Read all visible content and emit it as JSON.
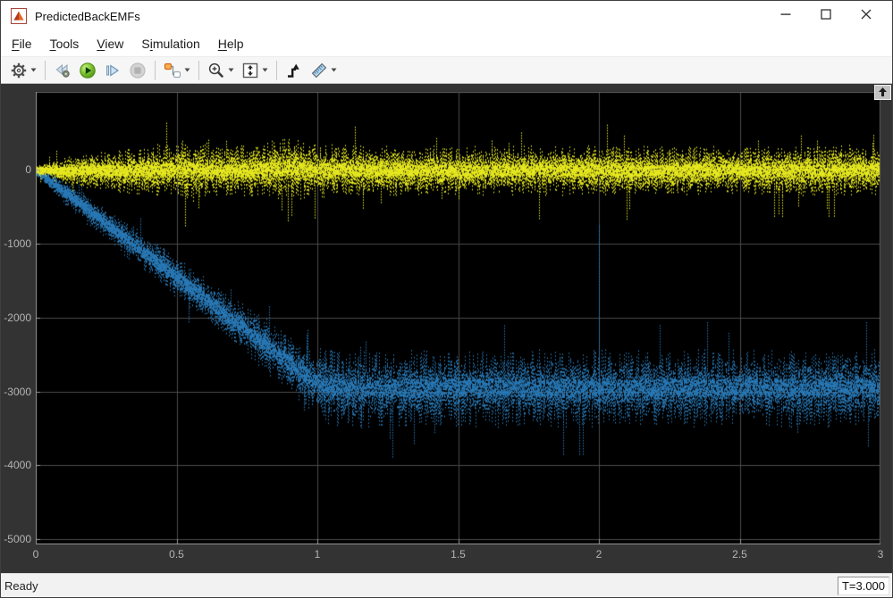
{
  "window": {
    "title": "PredictedBackEMFs",
    "controls": {
      "minimize": "minimize",
      "maximize": "maximize",
      "close": "close"
    }
  },
  "menubar": {
    "items": [
      {
        "label": "File",
        "underline": 0
      },
      {
        "label": "Tools",
        "underline": 0
      },
      {
        "label": "View",
        "underline": 0
      },
      {
        "label": "Simulation",
        "underline": 1
      },
      {
        "label": "Help",
        "underline": 0
      }
    ]
  },
  "toolbar": {
    "items": [
      {
        "icon": "settings-gear-icon",
        "caret": true
      },
      {
        "separator": true
      },
      {
        "icon": "step-back-icon",
        "disabled": true
      },
      {
        "icon": "run-icon"
      },
      {
        "icon": "step-forward-icon"
      },
      {
        "icon": "stop-icon",
        "disabled": true
      },
      {
        "separator": true
      },
      {
        "icon": "simulink-blocks-icon",
        "caret": true
      },
      {
        "separator": true
      },
      {
        "icon": "zoom-in-icon",
        "caret": true
      },
      {
        "icon": "fit-to-view-icon",
        "caret": true
      },
      {
        "separator": true
      },
      {
        "icon": "trigger-icon"
      },
      {
        "icon": "measurements-icon",
        "caret": true
      }
    ]
  },
  "chart_data": {
    "type": "scatter",
    "title": "",
    "xlabel": "",
    "ylabel": "",
    "grid": true,
    "xlim": [
      0,
      3
    ],
    "ylim": [
      -5070,
      1050
    ],
    "xticks": {
      "values": [
        0,
        0.5,
        1,
        1.5,
        2,
        2.5,
        3
      ],
      "labels": [
        "0",
        "0.5",
        "1",
        "1.5",
        "2",
        "2.5",
        "3"
      ]
    },
    "yticks": {
      "values": [
        0,
        -1000,
        -2000,
        -3000,
        -4000,
        -5000
      ],
      "labels": [
        "0",
        "-1000",
        "-2000",
        "-3000",
        "-4000",
        "-5000"
      ]
    },
    "colors": {
      "plot_bg": "#000000",
      "margin_bg": "#333333",
      "grid": "#4b4b4b",
      "frame": "#9b9b9b",
      "frame_dim": "#5c5c5c",
      "tick_label": "#b4b4b4"
    },
    "series": [
      {
        "name": "predicted-backemf-blue",
        "color": "#2878b5",
        "seed": 7,
        "description": "noisy signal ramping from 0 at t=0 to about -2950 at t=1, then constant near -2950 until t=3",
        "envelope": [
          [
            0,
            0,
            80
          ],
          [
            0.1,
            -290,
            150
          ],
          [
            0.2,
            -580,
            180
          ],
          [
            0.3,
            -870,
            200
          ],
          [
            0.4,
            -1160,
            220
          ],
          [
            0.5,
            -1450,
            240
          ],
          [
            0.6,
            -1740,
            260
          ],
          [
            0.7,
            -2030,
            280
          ],
          [
            0.8,
            -2320,
            310
          ],
          [
            0.9,
            -2610,
            340
          ],
          [
            0.95,
            -2760,
            370
          ],
          [
            1.0,
            -2880,
            410
          ],
          [
            1.05,
            -2940,
            440
          ],
          [
            1.1,
            -2960,
            450
          ],
          [
            1.5,
            -2950,
            445
          ],
          [
            2.0,
            -2955,
            450
          ],
          [
            2.5,
            -2945,
            445
          ],
          [
            3.0,
            -2950,
            450
          ]
        ],
        "spikes": [
          {
            "x": 2.0,
            "from": -750,
            "to": -3250
          }
        ],
        "texture": {
          "dots_per_column": 8,
          "dash_prob": 0.8,
          "dash_min": 0.25,
          "dash_max": 1.2,
          "outlier_prob": 0.03,
          "outlier_factor": 1.6
        }
      },
      {
        "name": "predicted-backemf-yellow",
        "color": "#e6e81f",
        "seed": 11,
        "description": "noisy signal oscillating about 0 with band of roughly +/-300 for full duration",
        "envelope": [
          [
            0,
            0,
            60
          ],
          [
            0.05,
            0,
            110
          ],
          [
            0.1,
            -20,
            170
          ],
          [
            0.2,
            0,
            240
          ],
          [
            0.3,
            -15,
            270
          ],
          [
            0.4,
            0,
            290
          ],
          [
            0.5,
            15,
            330
          ],
          [
            0.55,
            0,
            370
          ],
          [
            0.65,
            -15,
            300
          ],
          [
            0.8,
            0,
            330
          ],
          [
            0.9,
            25,
            390
          ],
          [
            1.0,
            -10,
            330
          ],
          [
            1.2,
            0,
            300
          ],
          [
            1.5,
            -15,
            310
          ],
          [
            1.8,
            0,
            300
          ],
          [
            2.1,
            -10,
            300
          ],
          [
            2.4,
            0,
            295
          ],
          [
            2.7,
            -10,
            300
          ],
          [
            3.0,
            0,
            300
          ]
        ],
        "spikes": [],
        "texture": {
          "dots_per_column": 9,
          "dash_prob": 0.85,
          "dash_min": 0.25,
          "dash_max": 1.15,
          "outlier_prob": 0.04,
          "outlier_factor": 1.7
        }
      }
    ]
  },
  "statusbar": {
    "status": "Ready",
    "time": "T=3.000"
  }
}
